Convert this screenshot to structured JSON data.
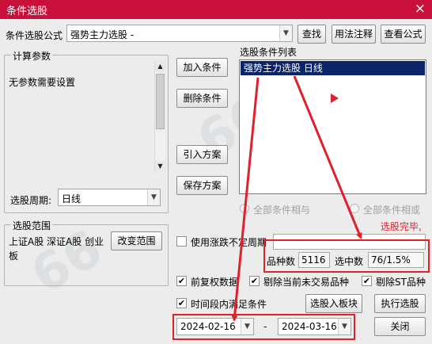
{
  "window": {
    "title": "条件选股",
    "close_glyph": "×"
  },
  "formula": {
    "label": "条件选股公式",
    "value": "强势主力选股  -",
    "find_button": "查找",
    "usage_button": "用法注释",
    "view_formula_button": "查看公式"
  },
  "params": {
    "group_title": "计算参数",
    "text": "无参数需要设置"
  },
  "period": {
    "label": "选股周期:",
    "value": "日线"
  },
  "actions": {
    "add_condition": "加入条件",
    "delete_condition": "删除条件",
    "import_scheme": "引入方案",
    "save_scheme": "保存方案"
  },
  "condition_list": {
    "label": "选股条件列表",
    "items": [
      "强势主力选股  日线"
    ]
  },
  "logic": {
    "all_and": "全部条件相与",
    "all_or": "全部条件相或"
  },
  "status": {
    "text": "选股完毕,",
    "color": "#e0202a"
  },
  "scope": {
    "group_title": "选股范围",
    "text": "上证A股 深证A股 创业板",
    "change_button": "改变范围"
  },
  "price_change": {
    "label": "使用涨跌不定周期",
    "checked": false
  },
  "counts": {
    "total_label": "品种数",
    "total_value": "5116",
    "selected_label": "选中数",
    "selected_value": "76/1.5%"
  },
  "options": {
    "adjusted": {
      "label": "前复权数据",
      "checked": true
    },
    "exclude_no_trade": {
      "label": "剔除当前未交易品种",
      "checked": true
    },
    "exclude_st": {
      "label": "剔除ST品种",
      "checked": true
    },
    "time_range": {
      "label": "时间段内满足条件",
      "checked": true
    }
  },
  "buttons": {
    "add_to_block": "选股入板块",
    "run": "执行选股",
    "close": "关闭"
  },
  "date_range": {
    "start": "2024-02-16",
    "separator": "-",
    "end": "2024-03-16"
  },
  "check_mark": "✔",
  "annotation_color": "#e0202a"
}
